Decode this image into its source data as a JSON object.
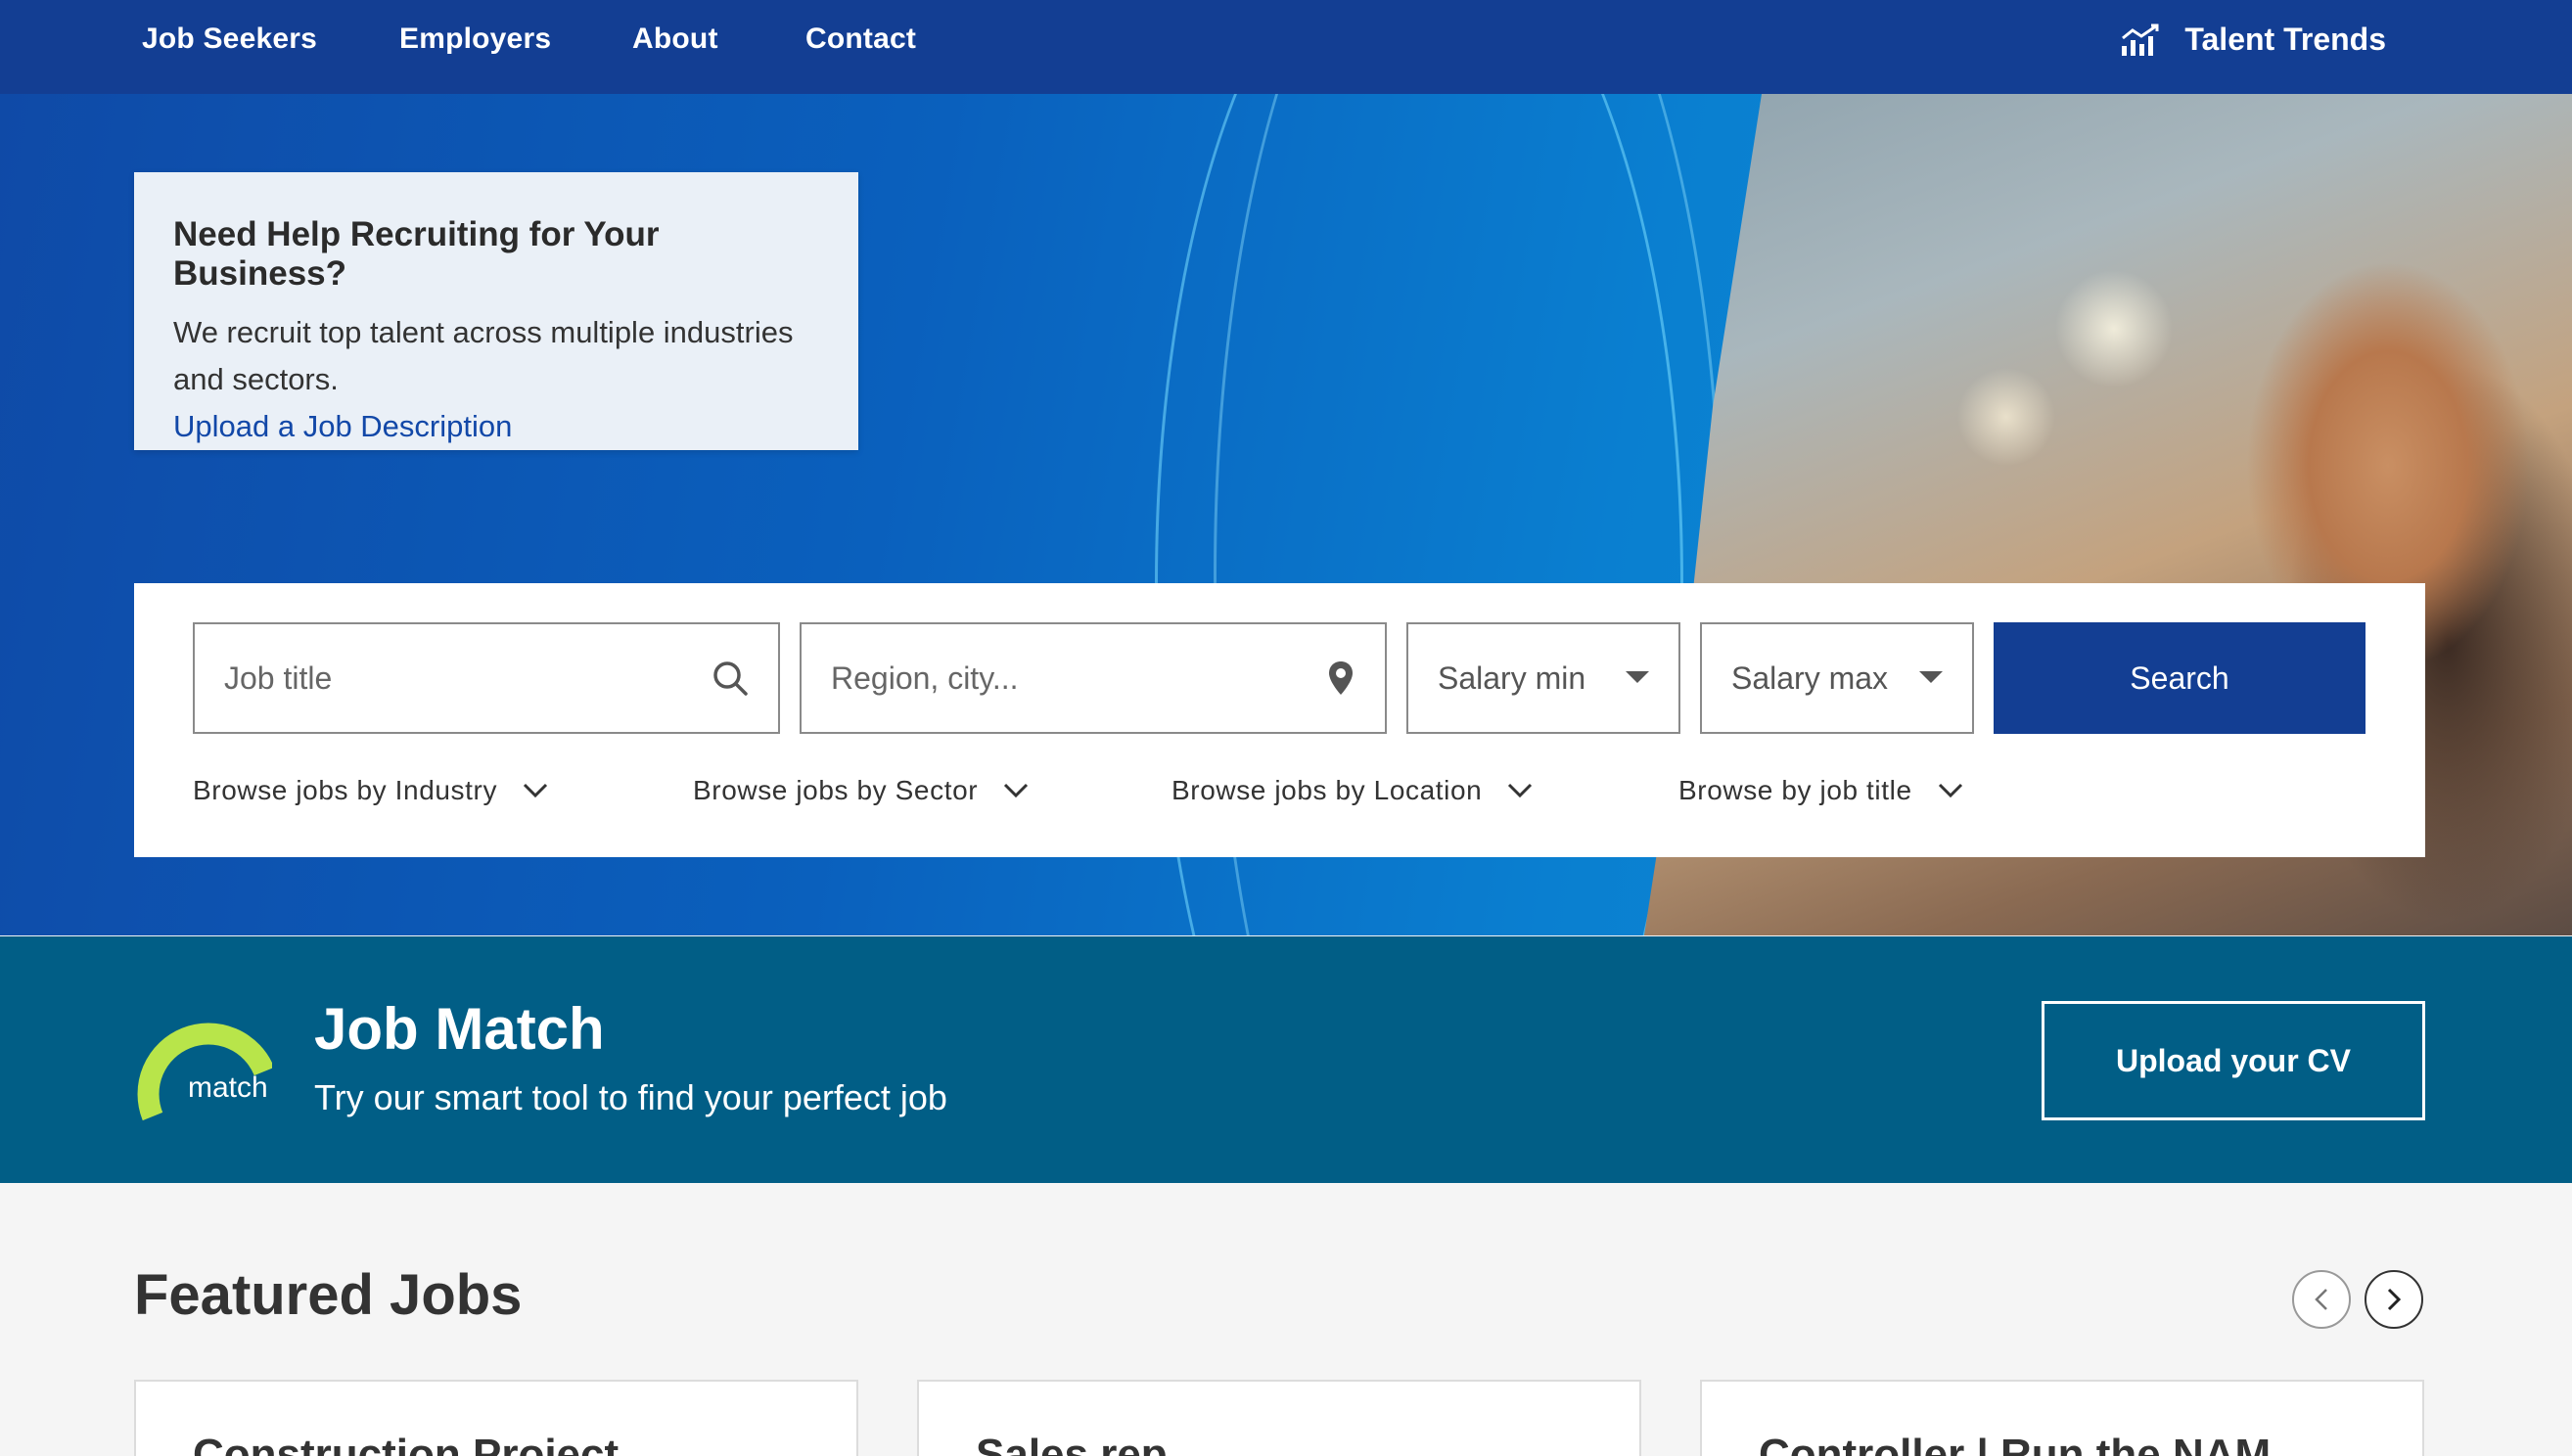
{
  "nav": {
    "links": [
      "Job Seekers",
      "Employers",
      "About",
      "Contact"
    ],
    "trends_label": "Talent Trends"
  },
  "recruit_card": {
    "title": "Need Help Recruiting for Your Business?",
    "body": "We recruit top talent across multiple industries and sectors.",
    "link": "Upload a Job Description"
  },
  "search": {
    "job_title_placeholder": "Job title",
    "location_placeholder": "Region, city...",
    "salary_min": "Salary min",
    "salary_max": "Salary max",
    "search_label": "Search",
    "browse": [
      "Browse jobs by Industry",
      "Browse jobs by Sector",
      "Browse jobs by Location",
      "Browse by job title"
    ]
  },
  "job_match": {
    "logo_text": "match",
    "title": "Job Match",
    "subtitle": "Try our smart tool to find your perfect job",
    "cta": "Upload your CV"
  },
  "featured": {
    "title": "Featured Jobs",
    "cards": [
      "Construction Project",
      "Sales rep",
      "Controller | Run the NAM"
    ]
  },
  "colors": {
    "nav_bg": "#133e93",
    "match_bg": "#015e86",
    "accent_green": "#b8e54a"
  }
}
